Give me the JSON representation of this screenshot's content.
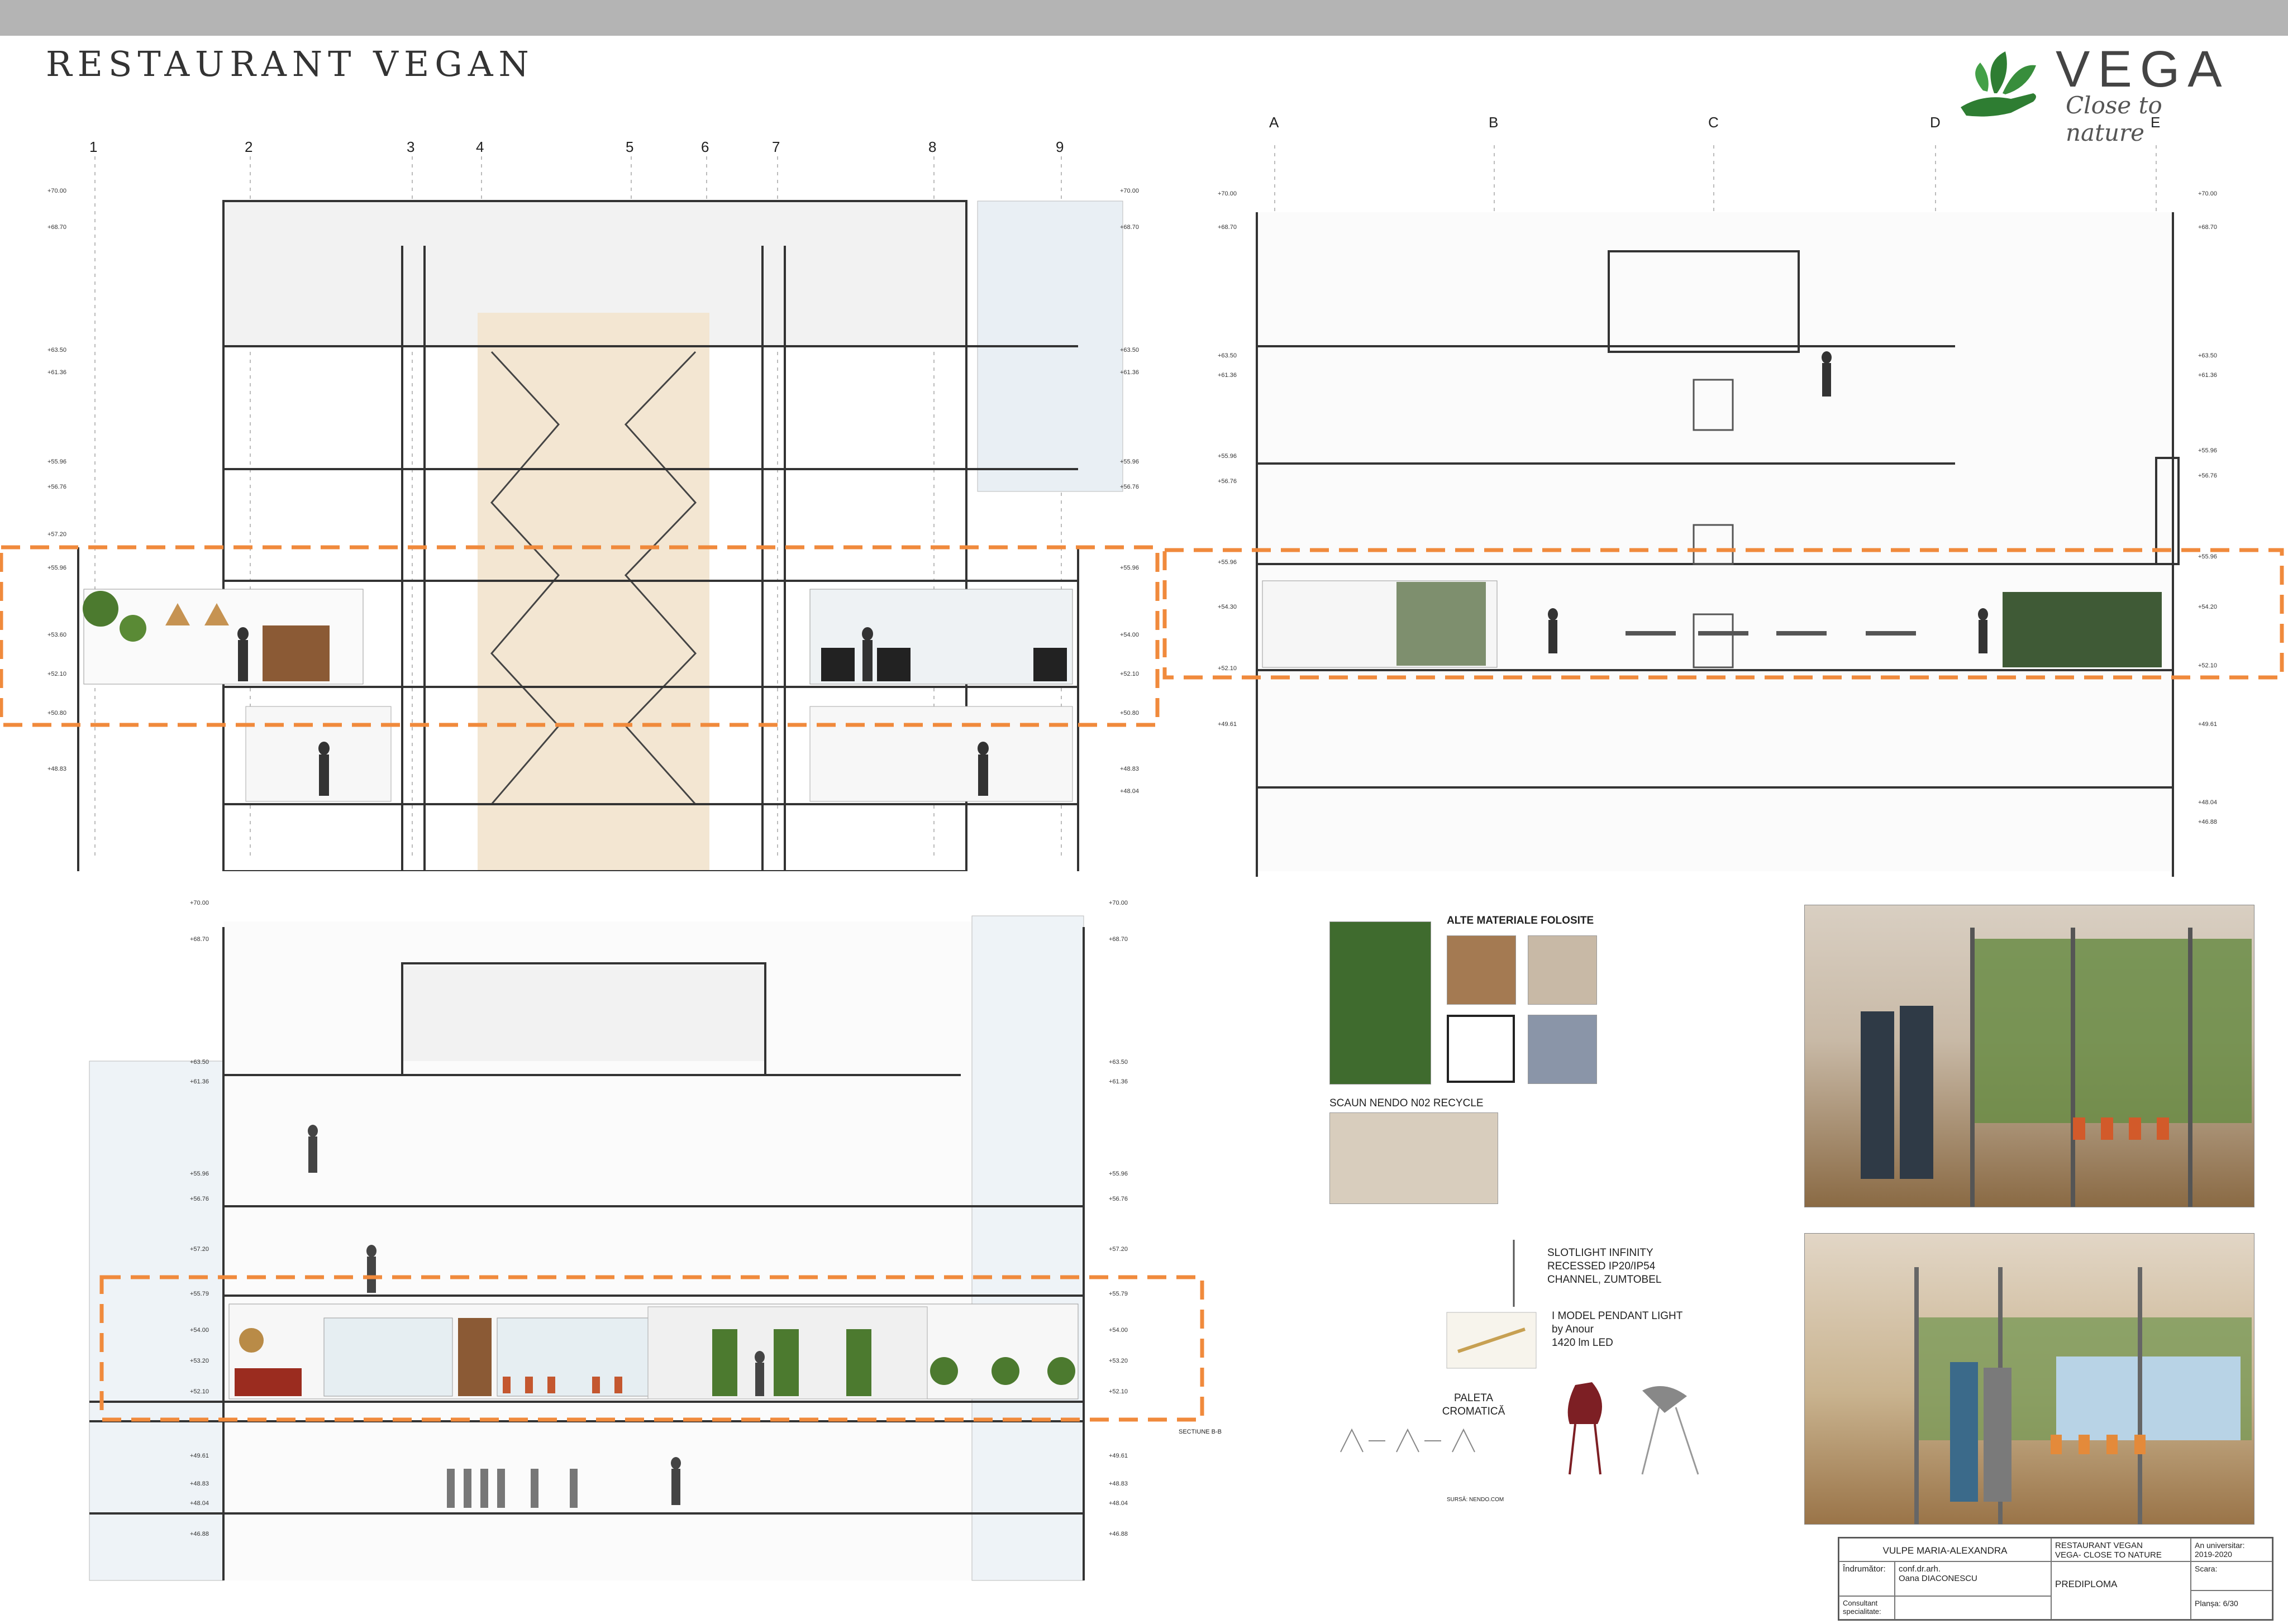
{
  "header": {
    "title": "RESTAURANT VEGAN",
    "logo_name": "VEGA",
    "logo_tagline": "Close to nature"
  },
  "section_top_left": {
    "axis_labels": [
      "1",
      "2",
      "3",
      "4",
      "5",
      "6",
      "7",
      "8",
      "9"
    ]
  },
  "section_top_right": {
    "axis_labels": [
      "A",
      "B",
      "C",
      "D",
      "E"
    ]
  },
  "section_bottom": {
    "note": "SECTIUNE B-B"
  },
  "materials": {
    "heading": "ALTE MATERIALE FOLOSITE",
    "chair_label": "SCAUN NENDO N02 RECYCLE",
    "slotlight_label": "SLOTLIGHT INFINITY\nRECESSED IP20/IP54\nCHANNEL, ZUMTOBEL",
    "pendant_label": "I MODEL PENDANT LIGHT\nby Anour\n1420 lm LED",
    "palette_label": "PALETA\nCROMATICĂ",
    "source_credit": "SURSĂ: NENDO.COM"
  },
  "title_block": {
    "student": "VULPE MARIA-ALEXANDRA",
    "project_line1": "RESTAURANT VEGAN",
    "project_line2": "VEGA- CLOSE TO NATURE",
    "year_label": "An universitar:",
    "year_value": "2019-2020",
    "supervisor_label": "Îndrumător:",
    "supervisor_name_1": "conf.dr.arh.",
    "supervisor_name_2": "Oana DIACONESCU",
    "stage": "PREDIPLOMA",
    "scale_label": "Scara:",
    "consultant_label": "Consultant specialitate:",
    "sheet_label": "Planșa: 6/30"
  },
  "colors": {
    "highlight_dash": "#f08a3c",
    "stair_fill": "#f3e6d2",
    "logo_green": "#2e7d32"
  }
}
